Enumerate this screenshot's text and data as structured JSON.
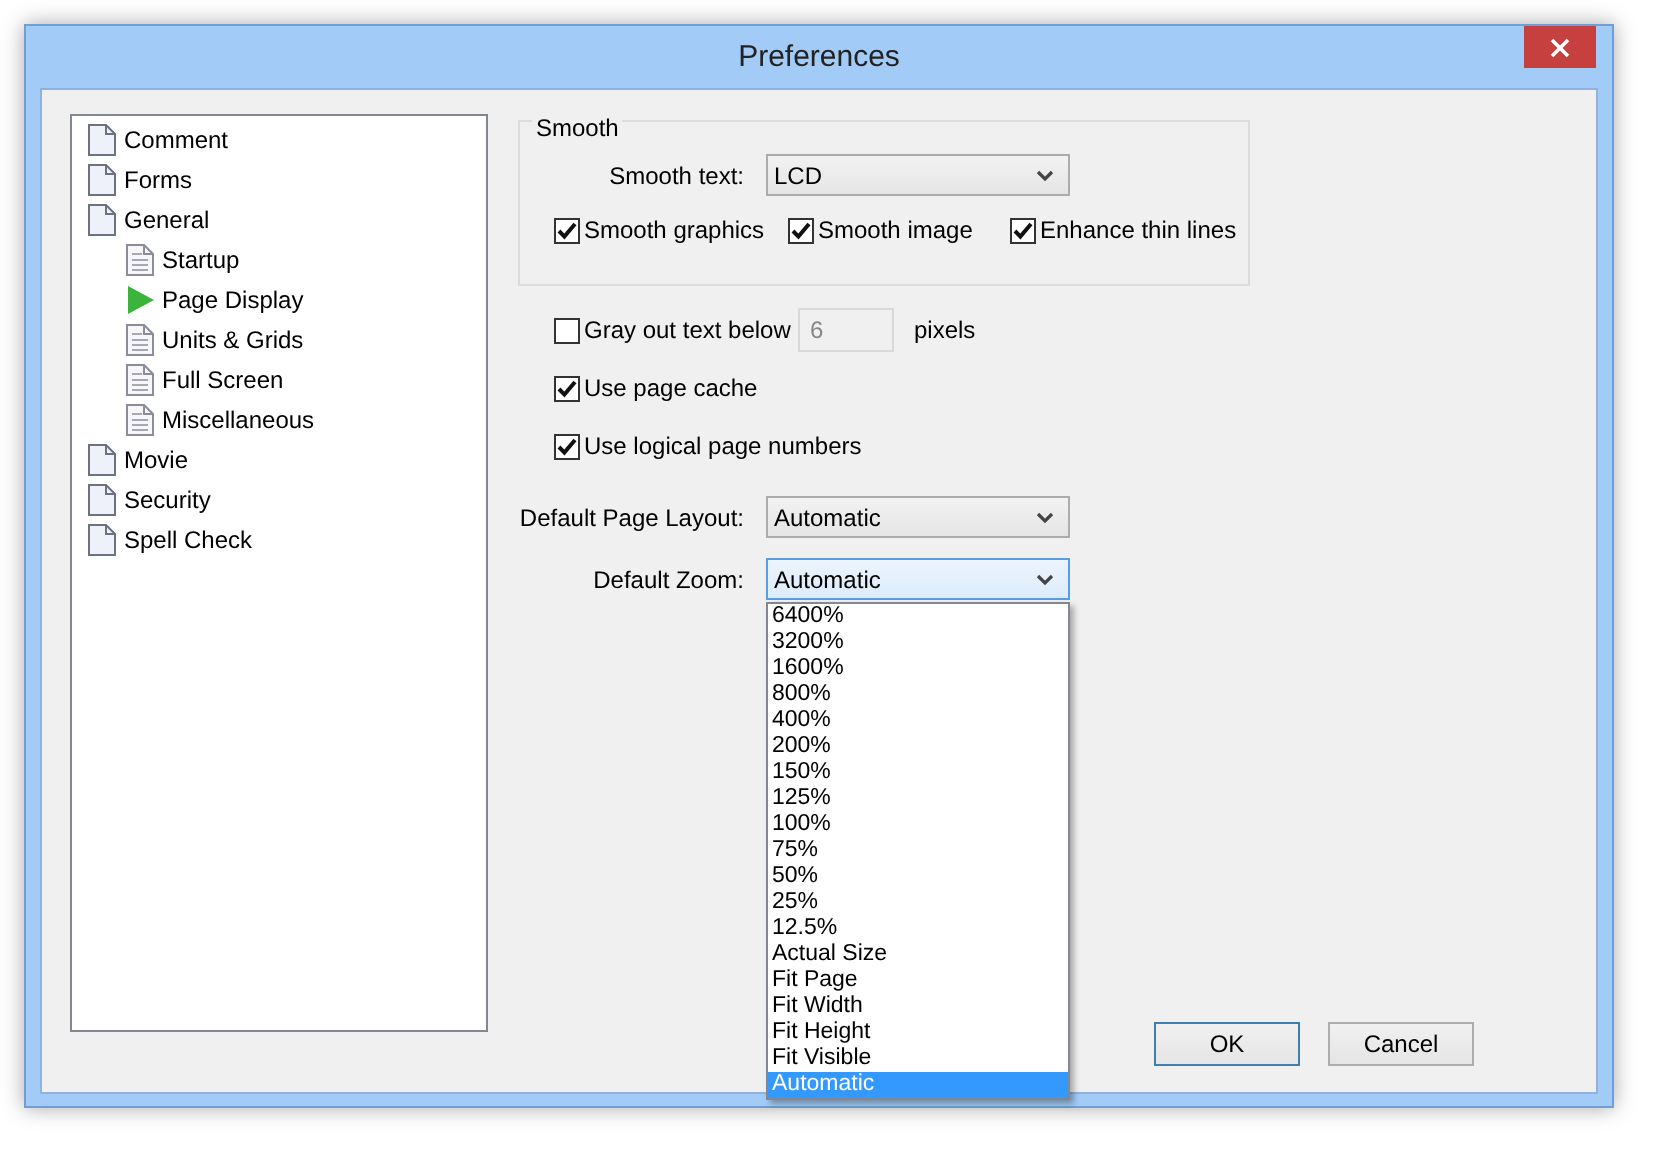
{
  "window": {
    "title": "Preferences"
  },
  "tree": [
    {
      "label": "Comment",
      "selected": false
    },
    {
      "label": "Forms",
      "selected": false
    },
    {
      "label": "General",
      "selected": false,
      "children": [
        {
          "label": "Startup",
          "selected": false
        },
        {
          "label": "Page Display",
          "selected": true
        },
        {
          "label": "Units & Grids",
          "selected": false
        },
        {
          "label": "Full Screen",
          "selected": false
        },
        {
          "label": "Miscellaneous",
          "selected": false
        }
      ]
    },
    {
      "label": "Movie",
      "selected": false
    },
    {
      "label": "Security",
      "selected": false
    },
    {
      "label": "Spell Check",
      "selected": false
    }
  ],
  "smooth": {
    "title": "Smooth",
    "smooth_text": {
      "label": "Smooth text:",
      "value": "LCD"
    },
    "options": [
      {
        "label": "Smooth graphics",
        "checked": true
      },
      {
        "label": "Smooth image",
        "checked": true
      },
      {
        "label": "Enhance thin lines",
        "checked": true
      }
    ]
  },
  "gray_out": {
    "label": "Gray out text below",
    "checked": false,
    "value": "6",
    "unit": "pixels"
  },
  "checks": [
    {
      "label": "Use page cache",
      "checked": true
    },
    {
      "label": "Use logical page numbers",
      "checked": true
    }
  ],
  "page_layout": {
    "label": "Default Page Layout:",
    "value": "Automatic"
  },
  "zoom": {
    "label": "Default Zoom:",
    "value": "Automatic",
    "expanded": true,
    "options": [
      {
        "label": "6400%",
        "selected": false
      },
      {
        "label": "3200%",
        "selected": false
      },
      {
        "label": "1600%",
        "selected": false
      },
      {
        "label": "800%",
        "selected": false
      },
      {
        "label": "400%",
        "selected": false
      },
      {
        "label": "200%",
        "selected": false
      },
      {
        "label": "150%",
        "selected": false
      },
      {
        "label": "125%",
        "selected": false
      },
      {
        "label": "100%",
        "selected": false
      },
      {
        "label": "75%",
        "selected": false
      },
      {
        "label": "50%",
        "selected": false
      },
      {
        "label": "25%",
        "selected": false
      },
      {
        "label": "12.5%",
        "selected": false
      },
      {
        "label": "Actual Size",
        "selected": false
      },
      {
        "label": "Fit Page",
        "selected": false
      },
      {
        "label": "Fit Width",
        "selected": false
      },
      {
        "label": "Fit Height",
        "selected": false
      },
      {
        "label": "Fit Visible",
        "selected": false
      },
      {
        "label": "Automatic",
        "selected": true
      }
    ]
  },
  "buttons": [
    {
      "label": "OK",
      "default": true
    },
    {
      "label": "Cancel",
      "default": false
    }
  ]
}
